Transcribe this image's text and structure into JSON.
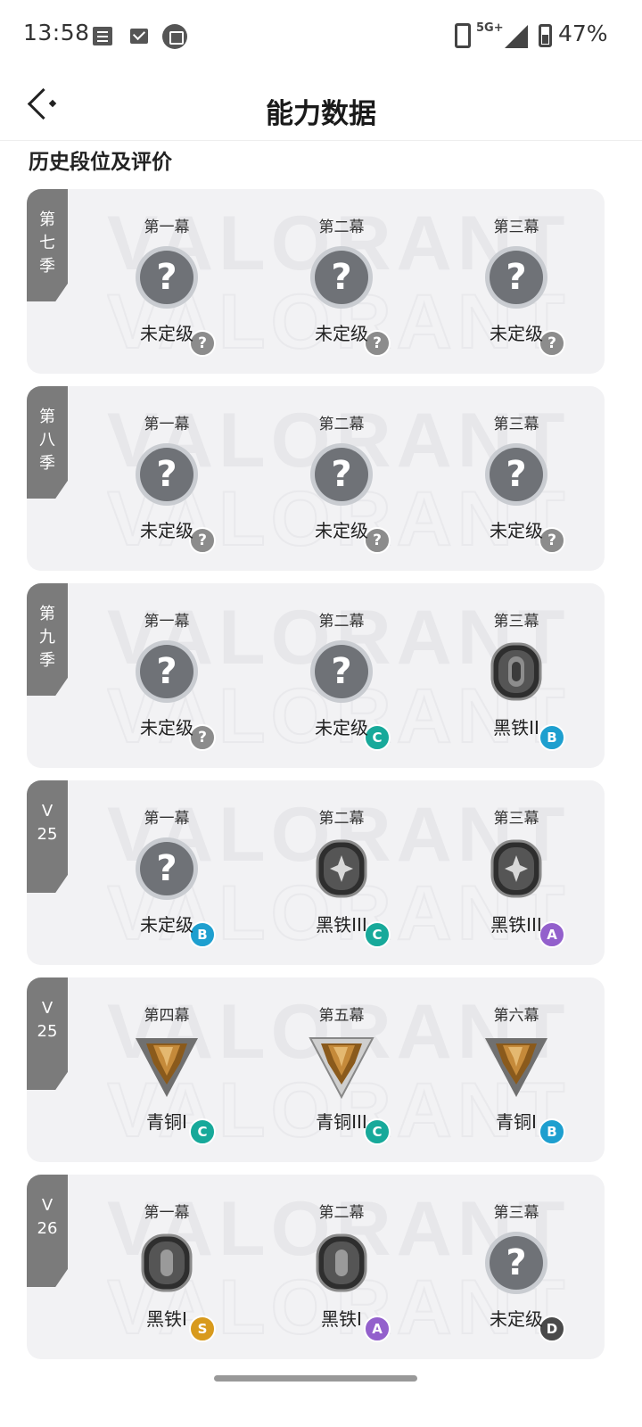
{
  "status_bar": {
    "time": "13:58",
    "network": "5G+",
    "battery": "47%",
    "icons": [
      "news-icon",
      "mail-icon",
      "calendar-icon",
      "data-icon",
      "signal-icon",
      "battery-icon"
    ]
  },
  "header": {
    "title": "能力数据"
  },
  "section_title": "历史段位及评价",
  "watermark_text": "VALORANT",
  "seasons": [
    {
      "tab": [
        "第",
        "七",
        "季"
      ],
      "acts": [
        {
          "name": "第一幕",
          "rank": "未定级",
          "icon": "unranked",
          "grade": "?"
        },
        {
          "name": "第二幕",
          "rank": "未定级",
          "icon": "unranked",
          "grade": "?"
        },
        {
          "name": "第三幕",
          "rank": "未定级",
          "icon": "unranked",
          "grade": "?"
        }
      ]
    },
    {
      "tab": [
        "第",
        "八",
        "季"
      ],
      "acts": [
        {
          "name": "第一幕",
          "rank": "未定级",
          "icon": "unranked",
          "grade": "?"
        },
        {
          "name": "第二幕",
          "rank": "未定级",
          "icon": "unranked",
          "grade": "?"
        },
        {
          "name": "第三幕",
          "rank": "未定级",
          "icon": "unranked",
          "grade": "?"
        }
      ]
    },
    {
      "tab": [
        "第",
        "九",
        "季"
      ],
      "acts": [
        {
          "name": "第一幕",
          "rank": "未定级",
          "icon": "unranked",
          "grade": "?"
        },
        {
          "name": "第二幕",
          "rank": "未定级",
          "icon": "unranked",
          "grade": "C"
        },
        {
          "name": "第三幕",
          "rank": "黑铁II",
          "icon": "iron2",
          "grade": "B"
        }
      ]
    },
    {
      "tab": [
        "V",
        "25"
      ],
      "acts": [
        {
          "name": "第一幕",
          "rank": "未定级",
          "icon": "unranked",
          "grade": "B"
        },
        {
          "name": "第二幕",
          "rank": "黑铁III",
          "icon": "iron3",
          "grade": "C"
        },
        {
          "name": "第三幕",
          "rank": "黑铁III",
          "icon": "iron3",
          "grade": "A"
        }
      ]
    },
    {
      "tab": [
        "V",
        "25"
      ],
      "acts": [
        {
          "name": "第四幕",
          "rank": "青铜I",
          "icon": "bronze1",
          "grade": "C"
        },
        {
          "name": "第五幕",
          "rank": "青铜III",
          "icon": "bronze3",
          "grade": "C"
        },
        {
          "name": "第六幕",
          "rank": "青铜I",
          "icon": "bronze1",
          "grade": "B"
        }
      ]
    },
    {
      "tab": [
        "V",
        "26"
      ],
      "acts": [
        {
          "name": "第一幕",
          "rank": "黑铁I",
          "icon": "iron1",
          "grade": "S"
        },
        {
          "name": "第二幕",
          "rank": "黑铁I",
          "icon": "iron1",
          "grade": "A"
        },
        {
          "name": "第三幕",
          "rank": "未定级",
          "icon": "unranked",
          "grade": "D"
        }
      ]
    }
  ]
}
